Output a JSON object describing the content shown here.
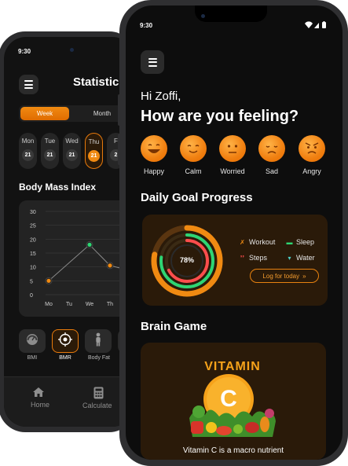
{
  "back_phone": {
    "status_time": "9:30",
    "title": "Statistics",
    "segments": {
      "week": "Week",
      "month": "Month"
    },
    "days": [
      {
        "label": "Mon",
        "num": "21"
      },
      {
        "label": "Tue",
        "num": "21"
      },
      {
        "label": "Wed",
        "num": "21"
      },
      {
        "label": "Thu",
        "num": "21"
      },
      {
        "label": "F",
        "num": "2"
      }
    ],
    "bmi_title": "Body Mass Index",
    "chart_data": {
      "type": "line",
      "categories": [
        "Mo",
        "Tu",
        "We",
        "Th"
      ],
      "y_ticks": [
        "30",
        "25",
        "20",
        "15",
        "10",
        "5",
        "0"
      ],
      "ylim": [
        0,
        30
      ],
      "grid": true,
      "visible_points": [
        {
          "x": "Mo",
          "y": 5,
          "color": "#f08a12"
        },
        {
          "x": "We",
          "y": 18,
          "color": "#2ed573"
        },
        {
          "x": "Th",
          "y": 10.5,
          "color": "#f08a12"
        }
      ]
    },
    "metrics": [
      {
        "label": "BMI",
        "icon": "gauge-icon"
      },
      {
        "label": "BMR",
        "icon": "target-icon"
      },
      {
        "label": "Body Fat",
        "icon": "body-icon"
      },
      {
        "label": "B",
        "icon": "partial-icon"
      }
    ],
    "nav": {
      "home": "Home",
      "calculate": "Calculate"
    }
  },
  "front_phone": {
    "status_time": "9:30",
    "greeting": "Hi Zoffi,",
    "question": "How are you feeling?",
    "moods": [
      {
        "label": "Happy",
        "icon": "happy-face-icon"
      },
      {
        "label": "Calm",
        "icon": "calm-face-icon"
      },
      {
        "label": "Worried",
        "icon": "worried-face-icon"
      },
      {
        "label": "Sad",
        "icon": "sad-face-icon"
      },
      {
        "label": "Angry",
        "icon": "angry-face-icon"
      }
    ],
    "goal_title": "Daily Goal Progress",
    "goal_percent": "78%",
    "goal_progress_fraction": 0.78,
    "legend": [
      {
        "label": "Workout",
        "icon": "dumbbell-icon",
        "color": "#f08a12"
      },
      {
        "label": "Sleep",
        "icon": "bed-icon",
        "color": "#2ed573"
      },
      {
        "label": "Steps",
        "icon": "footsteps-icon",
        "color": "#ff4d4d"
      },
      {
        "label": "Water",
        "icon": "water-glass-icon",
        "color": "#4dd0c8"
      }
    ],
    "log_button": "Log for today",
    "brain_game_title": "Brain Game",
    "game_word": "VITAMIN",
    "game_letter": "C",
    "game_caption": "Vitamin C is a macro nutrient"
  },
  "colors": {
    "accent": "#f08a12",
    "background": "#0d0d0d",
    "card": "#2a1a09"
  }
}
